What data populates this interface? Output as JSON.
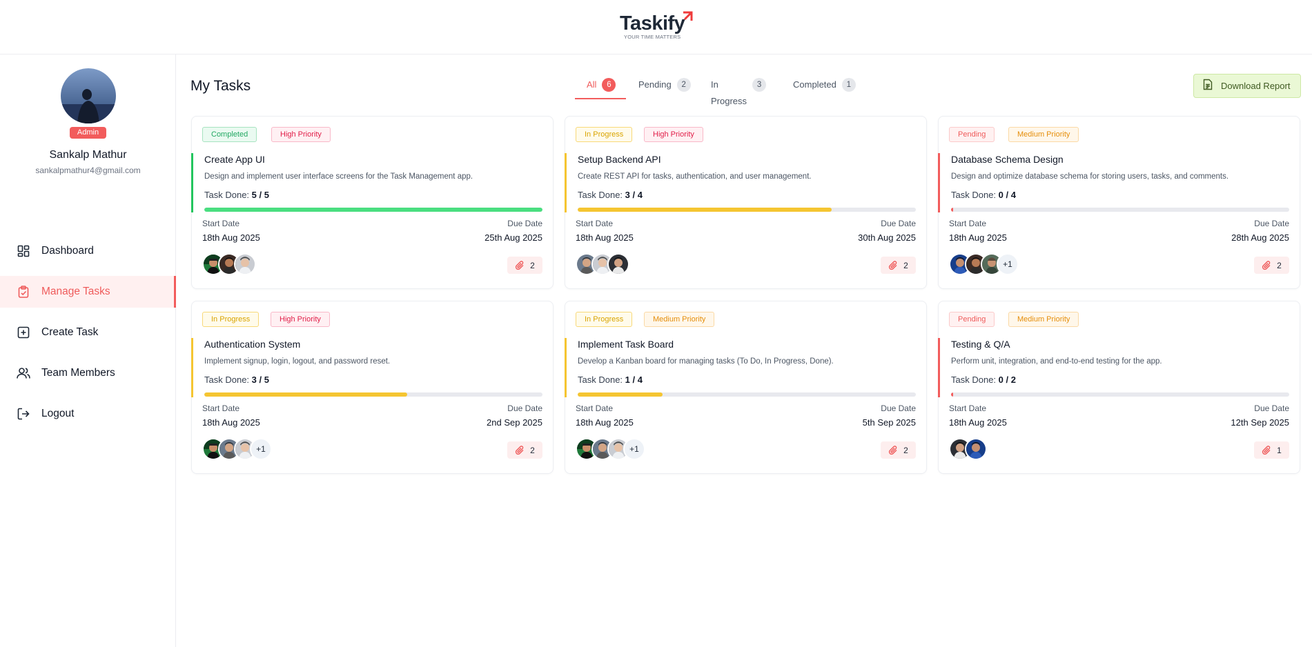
{
  "brand": {
    "name": "Taskify",
    "tagline": "YOUR TIME MATTERS",
    "accent": "#f25c5c"
  },
  "profile": {
    "name": "Sankalp Mathur",
    "email": "sankalpmathur4@gmail.com",
    "role": "Admin"
  },
  "sidebar": {
    "items": [
      {
        "label": "Dashboard",
        "icon": "dashboard-icon",
        "active": false
      },
      {
        "label": "Manage Tasks",
        "icon": "clipboard-icon",
        "active": true
      },
      {
        "label": "Create Task",
        "icon": "plus-square-icon",
        "active": false
      },
      {
        "label": "Team Members",
        "icon": "users-icon",
        "active": false
      },
      {
        "label": "Logout",
        "icon": "logout-icon",
        "active": false
      }
    ]
  },
  "main": {
    "title": "My Tasks",
    "tabs": [
      {
        "label": "All",
        "count": "6",
        "active": true
      },
      {
        "label": "Pending",
        "count": "2",
        "active": false
      },
      {
        "label": "In Progress",
        "count": "3",
        "active": false
      },
      {
        "label": "Completed",
        "count": "1",
        "active": false
      }
    ],
    "download_label": "Download Report"
  },
  "labels": {
    "task_done": "Task Done:",
    "start_date": "Start Date",
    "due_date": "Due Date"
  },
  "tasks": [
    {
      "status": "Completed",
      "priority": "High Priority",
      "title": "Create App UI",
      "description": "Design and implement user interface screens for the Task Management app.",
      "done": "5 / 5",
      "progress": 1.0,
      "start": "18th Aug 2025",
      "due": "25th Aug 2025",
      "extra_members": "",
      "attachments": "2"
    },
    {
      "status": "In Progress",
      "priority": "High Priority",
      "title": "Setup Backend API",
      "description": "Create REST API for tasks, authentication, and user management.",
      "done": "3 / 4",
      "progress": 0.75,
      "start": "18th Aug 2025",
      "due": "30th Aug 2025",
      "extra_members": "",
      "attachments": "2"
    },
    {
      "status": "Pending",
      "priority": "Medium Priority",
      "title": "Database Schema Design",
      "description": "Design and optimize database schema for storing users, tasks, and comments.",
      "done": "0 / 4",
      "progress": 0.0,
      "start": "18th Aug 2025",
      "due": "28th Aug 2025",
      "extra_members": "+1",
      "attachments": "2"
    },
    {
      "status": "In Progress",
      "priority": "High Priority",
      "title": "Authentication System",
      "description": "Implement signup, login, logout, and password reset.",
      "done": "3 / 5",
      "progress": 0.6,
      "start": "18th Aug 2025",
      "due": "2nd Sep 2025",
      "extra_members": "+1",
      "attachments": "2"
    },
    {
      "status": "In Progress",
      "priority": "Medium Priority",
      "title": "Implement Task Board",
      "description": "Develop a Kanban board for managing tasks (To Do, In Progress, Done).",
      "done": "1 / 4",
      "progress": 0.25,
      "start": "18th Aug 2025",
      "due": "5th Sep 2025",
      "extra_members": "+1",
      "attachments": "2"
    },
    {
      "status": "Pending",
      "priority": "Medium Priority",
      "title": "Testing & Q/A",
      "description": "Perform unit, integration, and end-to-end testing for the app.",
      "done": "0 / 2",
      "progress": 0.0,
      "start": "18th Aug 2025",
      "due": "12th Sep 2025",
      "extra_members": "",
      "attachments": "1"
    }
  ],
  "colors": {
    "completed": "#22c55e",
    "in_progress": "#f5c531",
    "pending": "#f25c5c",
    "high_priority": "#e11d48",
    "medium_priority": "#f59e0b"
  }
}
